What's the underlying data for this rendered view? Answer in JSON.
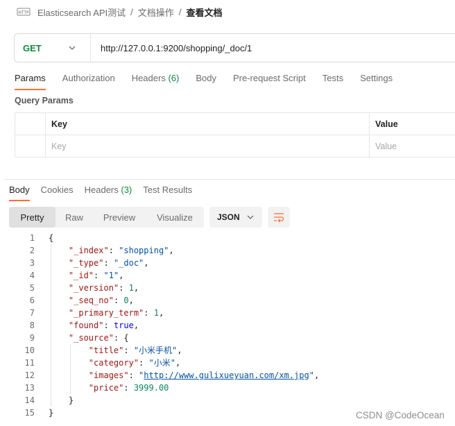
{
  "breadcrumb": {
    "icon": "http-request-icon",
    "collection": "Elasticsearch API测试",
    "folder": "文档操作",
    "request": "查看文档",
    "separator": "/"
  },
  "request": {
    "method": "GET",
    "url": "http://127.0.0.1:9200/shopping/_doc/1"
  },
  "request_tabs": [
    {
      "label": "Params",
      "active": true
    },
    {
      "label": "Authorization"
    },
    {
      "label": "Headers",
      "count": "(6)"
    },
    {
      "label": "Body"
    },
    {
      "label": "Pre-request Script"
    },
    {
      "label": "Tests"
    },
    {
      "label": "Settings"
    }
  ],
  "query_params": {
    "title": "Query Params",
    "headers": {
      "key": "Key",
      "value": "Value"
    },
    "placeholders": {
      "key": "Key",
      "value": "Value"
    }
  },
  "response_tabs": [
    {
      "label": "Body",
      "active": true
    },
    {
      "label": "Cookies"
    },
    {
      "label": "Headers",
      "count": "(3)"
    },
    {
      "label": "Test Results"
    }
  ],
  "view_modes": [
    "Pretty",
    "Raw",
    "Preview",
    "Visualize"
  ],
  "active_view": "Pretty",
  "format": "JSON",
  "code_lines": [
    "1",
    "2",
    "3",
    "4",
    "5",
    "6",
    "7",
    "8",
    "9",
    "10",
    "11",
    "12",
    "13",
    "14",
    "15"
  ],
  "body": {
    "keys": {
      "index": "\"_index\"",
      "type": "\"_type\"",
      "id": "\"_id\"",
      "version": "\"_version\"",
      "seq_no": "\"_seq_no\"",
      "primary_term": "\"_primary_term\"",
      "found": "\"found\"",
      "source": "\"_source\"",
      "title": "\"title\"",
      "category": "\"category\"",
      "images": "\"images\"",
      "price": "\"price\""
    },
    "values": {
      "index": "\"shopping\"",
      "type": "\"_doc\"",
      "id": "\"1\"",
      "version": "1",
      "seq_no": "0",
      "primary_term": "1",
      "found": "true",
      "title": "\"小米手机\"",
      "category": "\"小米\"",
      "images": "http://www.gulixueyuan.com/xm.jpg",
      "price": "3999.00"
    }
  },
  "watermark": "CSDN @CodeOcean",
  "colors": {
    "accent": "#ff6c37",
    "method_get": "#0b8a3c"
  }
}
